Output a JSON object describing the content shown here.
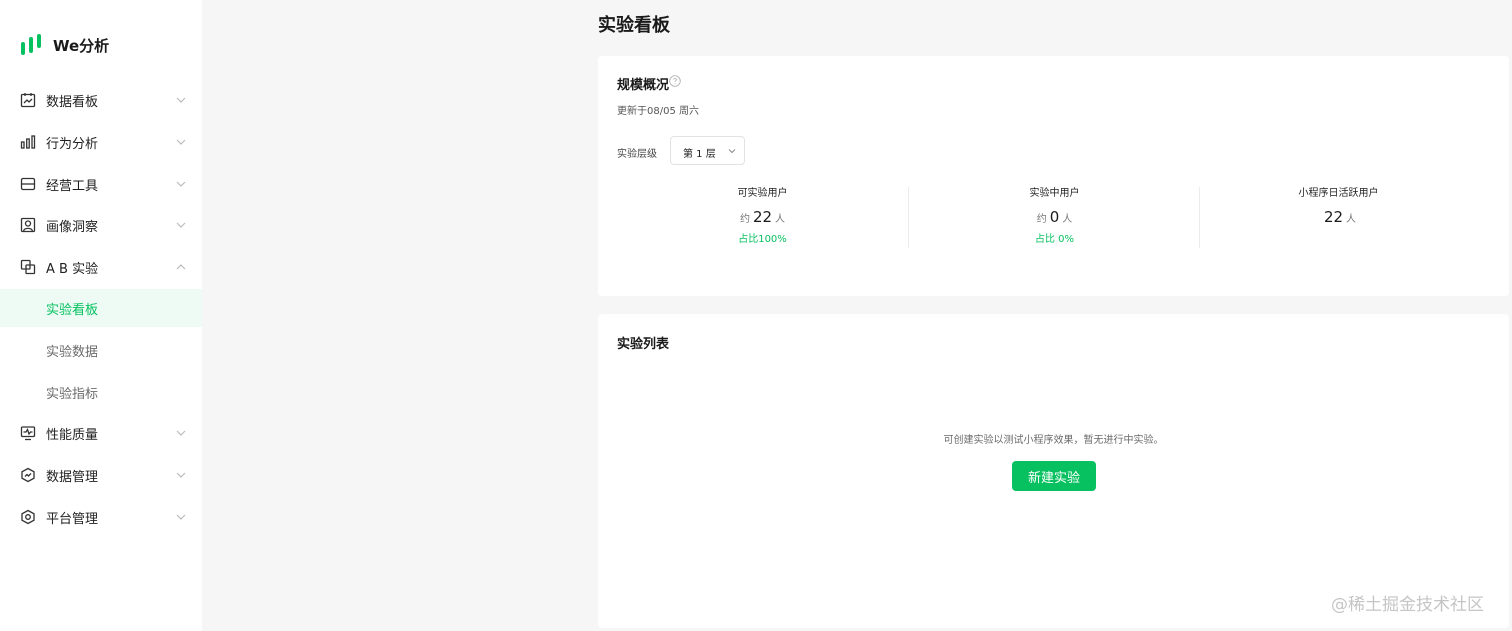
{
  "brand": {
    "name": "We分析"
  },
  "sidebar": {
    "items": [
      {
        "label": "数据看板",
        "icon": "chart-board-icon",
        "expanded": false
      },
      {
        "label": "行为分析",
        "icon": "bar-chart-icon",
        "expanded": false
      },
      {
        "label": "经营工具",
        "icon": "store-icon",
        "expanded": false
      },
      {
        "label": "画像洞察",
        "icon": "portrait-icon",
        "expanded": false
      },
      {
        "label": "A B 实验",
        "icon": "ab-test-icon",
        "expanded": true,
        "children": [
          {
            "label": "实验看板",
            "active": true
          },
          {
            "label": "实验数据",
            "active": false
          },
          {
            "label": "实验指标",
            "active": false
          }
        ]
      },
      {
        "label": "性能质量",
        "icon": "monitor-icon",
        "expanded": false
      },
      {
        "label": "数据管理",
        "icon": "data-manage-icon",
        "expanded": false
      },
      {
        "label": "平台管理",
        "icon": "settings-hex-icon",
        "expanded": false
      }
    ]
  },
  "page": {
    "title": "实验看板"
  },
  "overview": {
    "title": "规模概况",
    "updated": "更新于08/05 周六",
    "layer_label": "实验层级",
    "layer_value": "第 1 层",
    "stats": [
      {
        "label": "可实验用户",
        "prefix": "约",
        "value": "22",
        "unit": "人",
        "ratio": "占比100%"
      },
      {
        "label": "实验中用户",
        "prefix": "约",
        "value": "0",
        "unit": "人",
        "ratio": "占比 0%"
      },
      {
        "label": "小程序日活跃用户",
        "prefix": "",
        "value": "22",
        "unit": "人",
        "ratio": ""
      }
    ]
  },
  "experiments": {
    "title": "实验列表",
    "empty_text": "可创建实验以测试小程序效果，暂无进行中实验。",
    "new_button": "新建实验"
  },
  "watermark": "@稀土掘金技术社区",
  "colors": {
    "accent": "#07c160",
    "background": "#f6f6f6",
    "card": "#ffffff"
  }
}
